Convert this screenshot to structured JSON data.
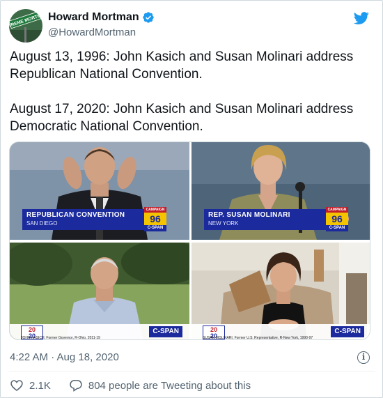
{
  "author": {
    "name": "Howard Mortman",
    "handle": "@HowardMortman",
    "avatar_sign": "EXTREME MORTMAN"
  },
  "tweet": {
    "paragraphs": [
      "August 13, 1996: John Kasich and Susan Molinari address Republican National Convention.",
      "August 17, 2020: John Kasich and Susan Molinari address Democratic National Convention."
    ]
  },
  "media": {
    "panel1": {
      "chyron_title": "REPUBLICAN CONVENTION",
      "chyron_sub": "SAN DIEGO",
      "badge_top": "CAMPAIGN",
      "badge_year": "96",
      "badge_bottom": "C-SPAN"
    },
    "panel2": {
      "chyron_title": "REP. SUSAN MOLINARI",
      "chyron_sub": "NEW YORK",
      "badge_top": "CAMPAIGN",
      "badge_year": "96",
      "badge_bottom": "C-SPAN"
    },
    "panel3": {
      "logo_top": "20",
      "logo_bottom": "20",
      "network": "C-SPAN",
      "caption": "JOHN KASICH, Former Governor, R-Ohio, 2011-19"
    },
    "panel4": {
      "logo_top": "20",
      "logo_bottom": "20",
      "network": "C-SPAN",
      "caption": "SUSAN MOLINARI, Former U.S. Representative, R-New York, 1990-97"
    }
  },
  "meta": {
    "timestamp": "4:22 AM · Aug 18, 2020"
  },
  "actions": {
    "likes": "2.1K",
    "reply_text": "804 people are Tweeting about this"
  },
  "colors": {
    "twitter_blue": "#1d9bf0",
    "cspan_blue": "#1b2a9c",
    "secondary_text": "#536471"
  }
}
